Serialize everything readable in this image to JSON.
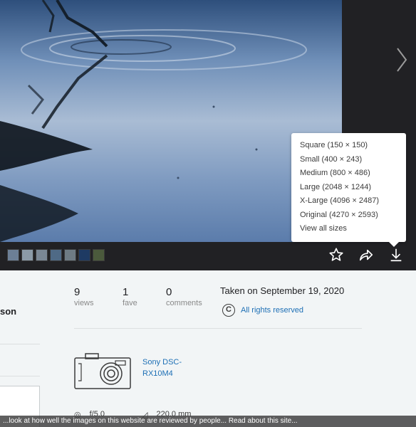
{
  "download_menu": {
    "items": [
      "Square (150 × 150)",
      "Small (400 × 243)",
      "Medium (800 × 486)",
      "Large (2048 × 1244)",
      "X-Large (4096 × 2487)",
      "Original (4270 × 2593)",
      "View all sizes"
    ]
  },
  "owner": {
    "name_fragment": "son"
  },
  "stats": {
    "views": {
      "count": "9",
      "label": "views"
    },
    "faves": {
      "count": "1",
      "label": "fave"
    },
    "comments": {
      "count": "0",
      "label": "comments"
    }
  },
  "taken_on": "Taken on September 19, 2020",
  "license": {
    "icon_text": "C",
    "label": "All rights reserved"
  },
  "camera": {
    "model": "Sony DSC-RX10M4"
  },
  "exif": {
    "aperture": "f/5.0",
    "focal_length": "220.0 mm"
  },
  "cookie_banner": {
    "text": "...look at how well the images on this website are reviewed by people... Read about this site..."
  },
  "colors": {
    "link": "#1d6fb5",
    "viewer_bg": "#212124",
    "page_bg": "#f2f5f6"
  },
  "icons": {
    "next": "chevron-right-icon",
    "fave": "star-icon",
    "share": "share-icon",
    "download": "download-icon",
    "license": "copyright-icon",
    "camera": "camera-icon"
  }
}
